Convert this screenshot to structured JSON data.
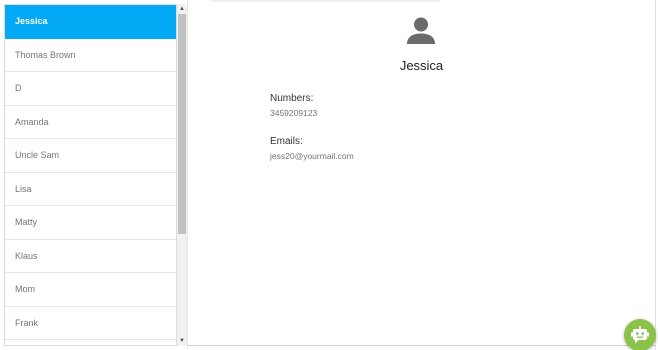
{
  "contacts": [
    {
      "name": "Jessica"
    },
    {
      "name": "Thomas Brown"
    },
    {
      "name": "D"
    },
    {
      "name": "Amanda"
    },
    {
      "name": "Uncle Sam"
    },
    {
      "name": "Lisa"
    },
    {
      "name": "Matty"
    },
    {
      "name": "Klaus"
    },
    {
      "name": "Mom"
    },
    {
      "name": "Frank"
    }
  ],
  "selected": {
    "name": "Jessica",
    "numbers_label": "Numbers:",
    "number": "3459209123",
    "emails_label": "Emails:",
    "email": "jess20@yourmail.com"
  },
  "icons": {
    "avatar": "person-icon",
    "scroll_up": "scroll-up-arrow-icon",
    "scroll_down": "scroll-down-arrow-icon",
    "bot": "chatbot-icon"
  },
  "colors": {
    "selected_item": "#03a9f4",
    "bot_button": "#8bc34a"
  }
}
